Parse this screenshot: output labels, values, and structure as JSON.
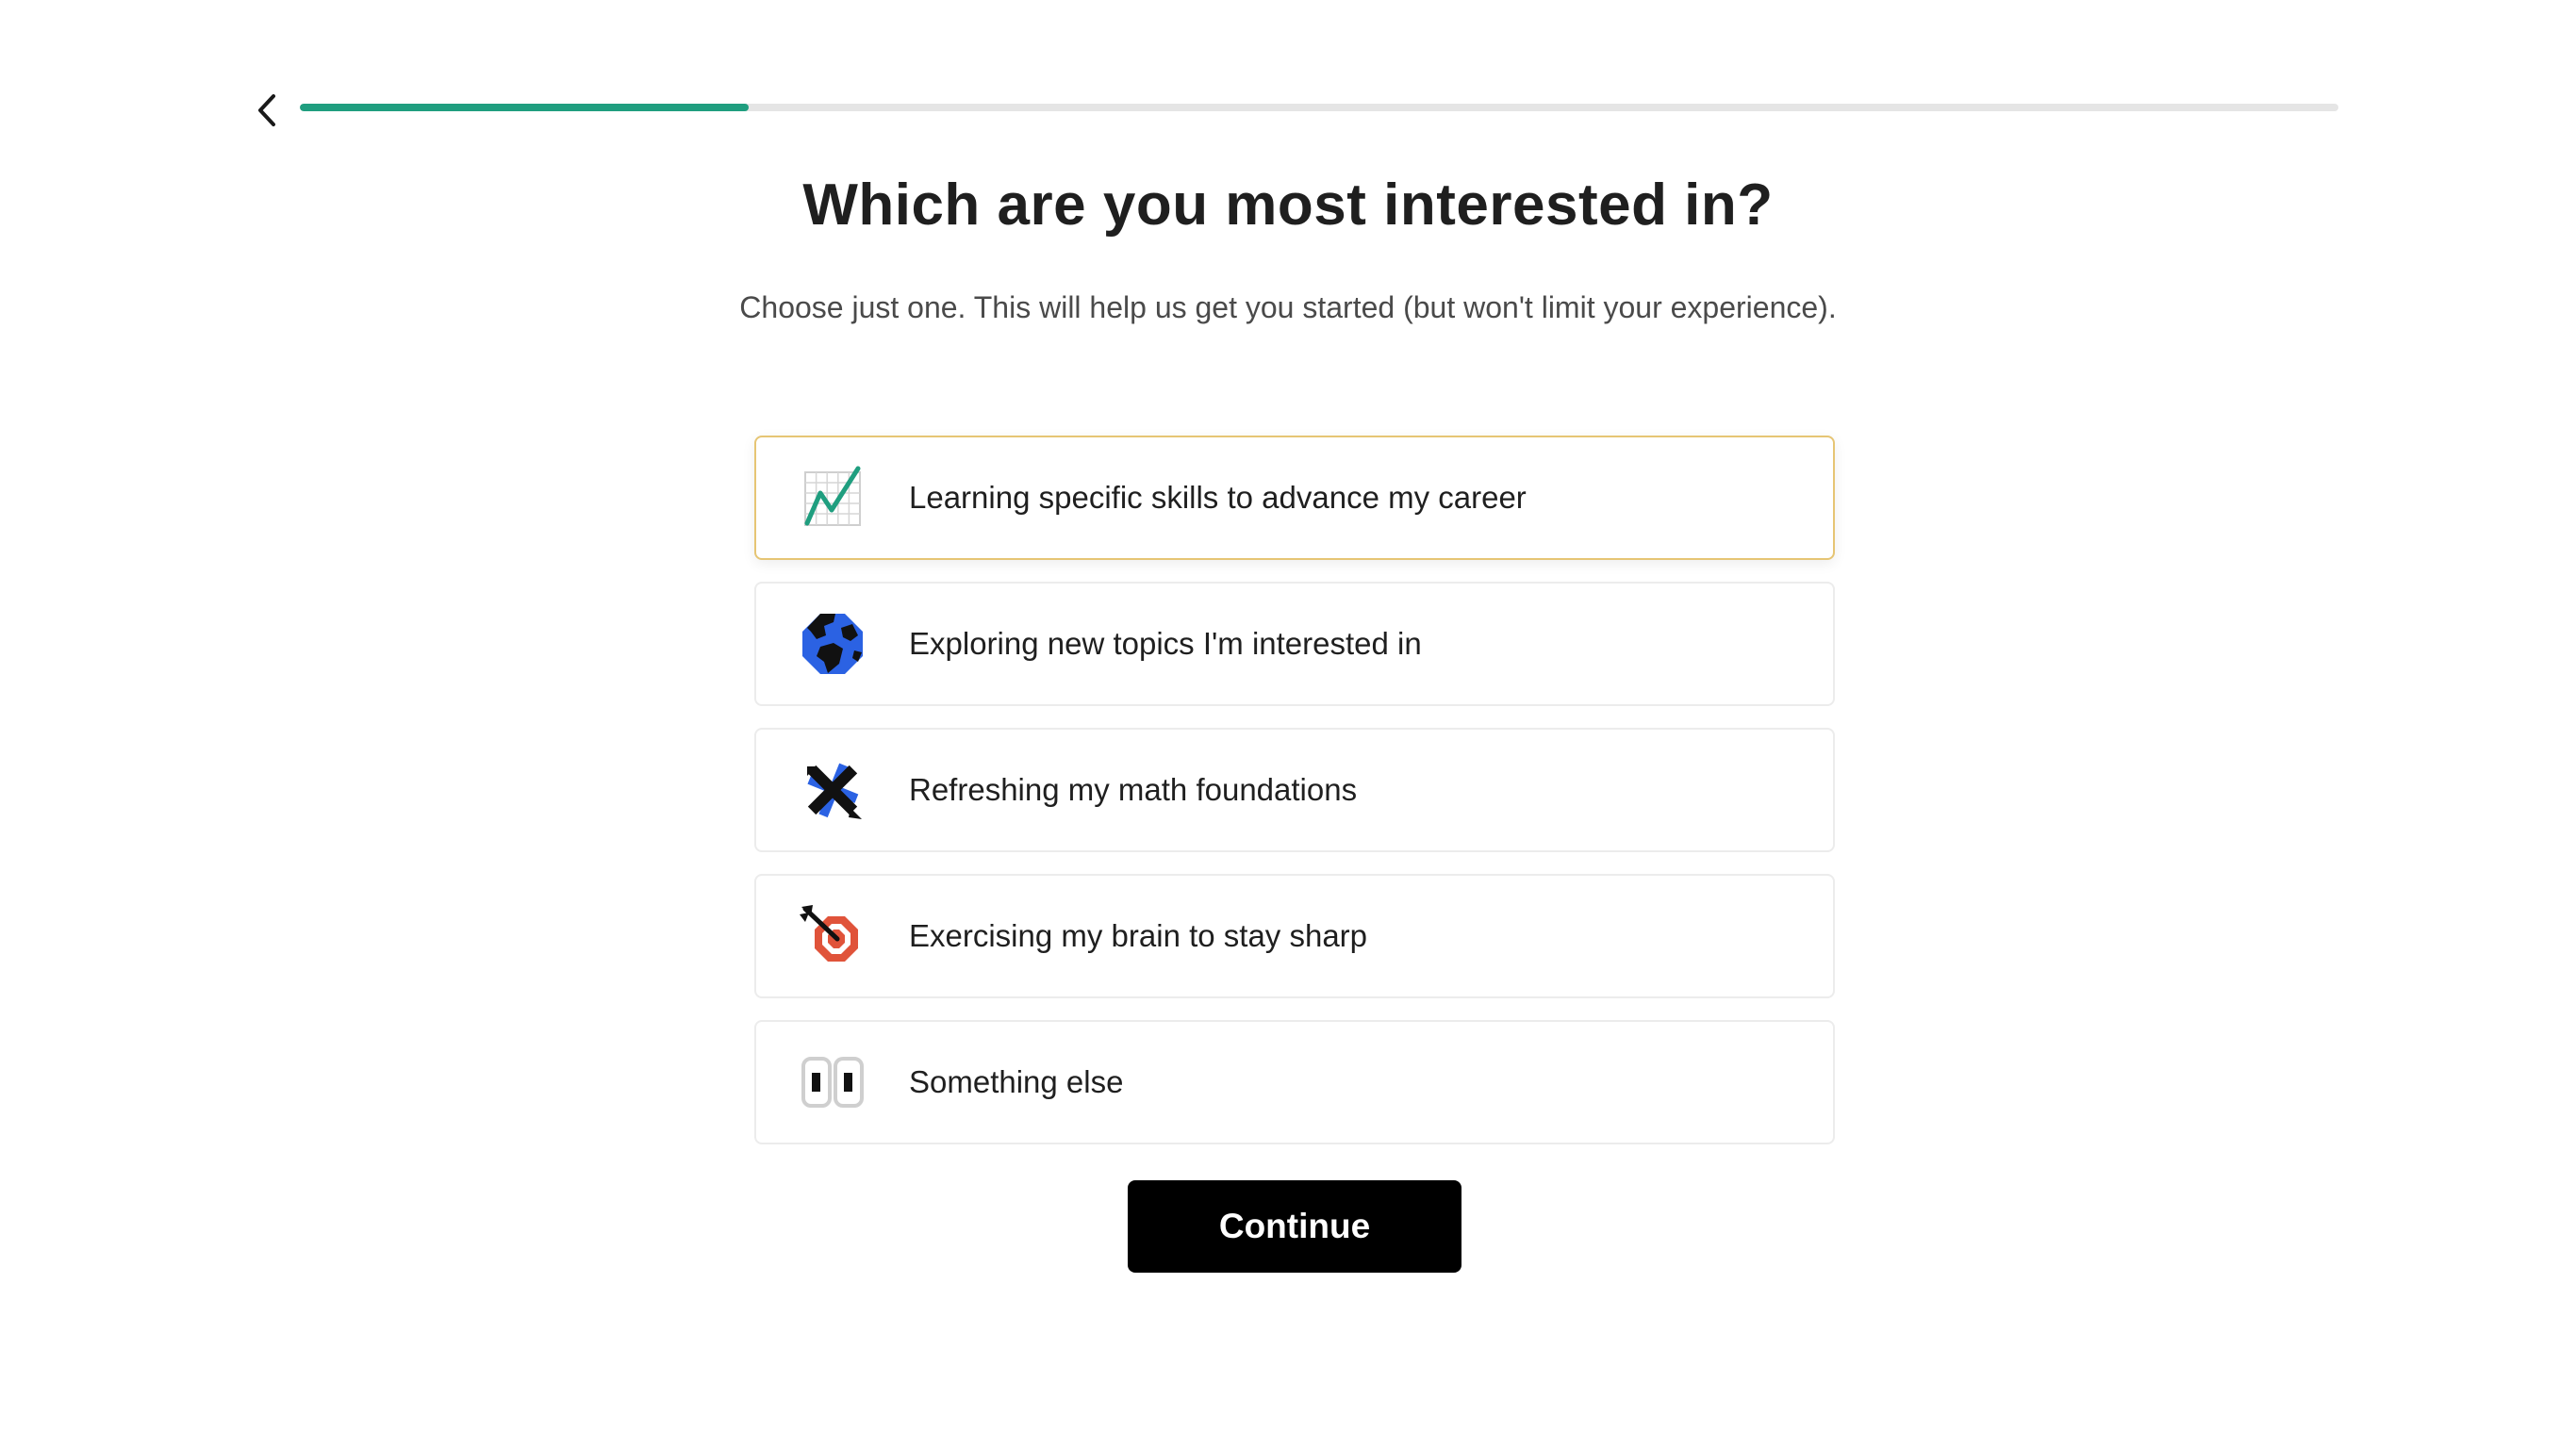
{
  "header": {
    "back_icon": "chevron-left-icon",
    "progress": 0.22,
    "progress_color": "#1f9e7f"
  },
  "question": {
    "title": "Which are you most interested in?",
    "subtitle": "Choose just one. This will help us get you started (but won't limit your experience)."
  },
  "options": [
    {
      "label": "Learning specific skills to advance my career",
      "icon": "chart-trend-icon",
      "selected": true
    },
    {
      "label": "Exploring new topics I'm interested in",
      "icon": "globe-icon",
      "selected": false
    },
    {
      "label": "Refreshing my math foundations",
      "icon": "math-operators-icon",
      "selected": false
    },
    {
      "label": "Exercising my brain to stay sharp",
      "icon": "target-dart-icon",
      "selected": false
    },
    {
      "label": "Something else",
      "icon": "eyes-icon",
      "selected": false
    }
  ],
  "footer": {
    "continue_label": "Continue"
  },
  "colors": {
    "selected_border": "#e6c574",
    "button_bg": "#000000",
    "accent_green": "#1f9e7f",
    "globe_blue": "#2b62e3",
    "target_red": "#e0533a"
  }
}
